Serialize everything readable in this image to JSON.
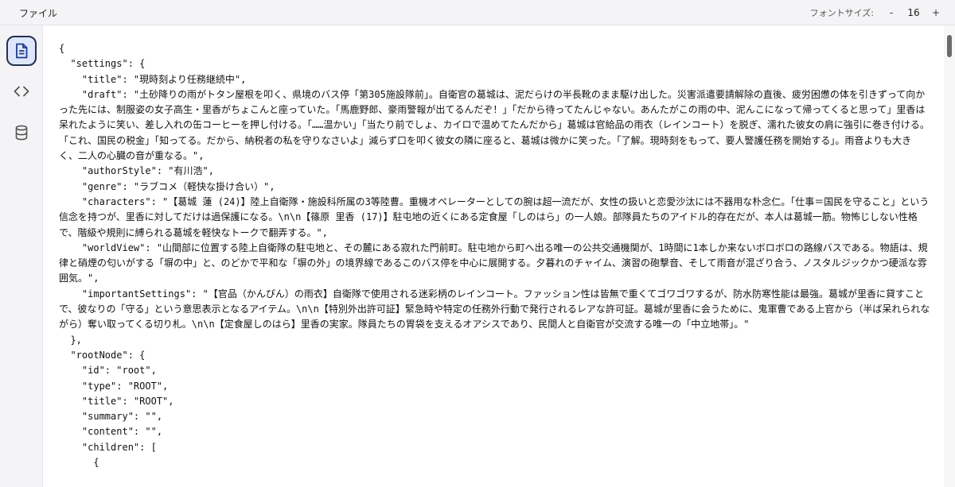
{
  "topbar": {
    "file_menu": "ファイル",
    "font_size_label": "フォントサイズ:",
    "decrease_label": "-",
    "font_size_value": "16",
    "increase_label": "+"
  },
  "sidebar": {
    "items": [
      {
        "icon": "document-icon",
        "active": true
      },
      {
        "icon": "code-icon",
        "active": false
      },
      {
        "icon": "database-icon",
        "active": false
      }
    ]
  },
  "editor": {
    "content": "{\n  \"settings\": {\n    \"title\": \"現時刻より任務継続中\",\n    \"draft\": \"土砂降りの雨がトタン屋根を叩く、県境のバス停「第305施設隊前」。自衛官の葛城は、泥だらけの半長靴のまま駆け出した。災害派遣要請解除の直後、疲労困憊の体を引きずって向かった先には、制服姿の女子高生・里香がちょこんと座っていた。「馬鹿野郎、豪雨警報が出てるんだぞ！」「だから待ってたんじゃない。あんたがこの雨の中、泥んこになって帰ってくると思って」里香は呆れたように笑い、差し入れの缶コーヒーを押し付ける。「……温かい」「当たり前でしょ、カイロで温めてたんだから」葛城は官給品の雨衣（レインコート）を脱ぎ、濡れた彼女の肩に強引に巻き付ける。「これ、国民の税金」「知ってる。だから、納税者の私を守りなさいよ」減らず口を叩く彼女の隣に座ると、葛城は微かに笑った。「了解。現時刻をもって、要人警護任務を開始する」。雨音よりも大きく、二人の心臓の音が重なる。\",\n    \"authorStyle\": \"有川浩\",\n    \"genre\": \"ラブコメ（軽快な掛け合い）\",\n    \"characters\": \"【葛城 蓮 (24)】陸上自衛隊・施設科所属の3等陸曹。重機オペレーターとしての腕は超一流だが、女性の扱いと恋愛沙汰には不器用な朴念仁。「仕事＝国民を守ること」という信念を持つが、里香に対してだけは過保護になる。\\n\\n【篠原 里香 (17)】駐屯地の近くにある定食屋「しのはら」の一人娘。部隊員たちのアイドル的存在だが、本人は葛城一筋。物怖じしない性格で、階級や規則に縛られる葛城を軽快なトークで翻弄する。\",\n    \"worldView\": \"山間部に位置する陸上自衛隊の駐屯地と、その麓にある寂れた門前町。駐屯地から町へ出る唯一の公共交通機関が、1時間に1本しか来ないボロボロの路線バスである。物語は、規律と硝煙の匂いがする「塀の中」と、のどかで平和な「塀の外」の境界線であるこのバス停を中心に展開する。夕暮れのチャイム、演習の砲撃音、そして雨音が混ざり合う、ノスタルジックかつ硬派な雰囲気。\",\n    \"importantSettings\": \"【官品（かんぴん）の雨衣】自衛隊で使用される迷彩柄のレインコート。ファッション性は皆無で重くてゴワゴワするが、防水防寒性能は最強。葛城が里香に貸すことで、彼なりの「守る」という意思表示となるアイテム。\\n\\n【特別外出許可証】緊急時や特定の任務外行動で発行されるレアな許可証。葛城が里香に会うために、鬼軍曹である上官から（半ば呆れられながら）奪い取ってくる切り札。\\n\\n【定食屋しのはら】里香の実家。隊員たちの胃袋を支えるオアシスであり、民間人と自衛官が交流する唯一の「中立地帯」。\"\n  },\n  \"rootNode\": {\n    \"id\": \"root\",\n    \"type\": \"ROOT\",\n    \"title\": \"ROOT\",\n    \"summary\": \"\",\n    \"content\": \"\",\n    \"children\": [\n      {"
  },
  "colors": {
    "chrome_bg": "#f4f4f6",
    "active_bg": "#dde6fb",
    "active_border": "#24324d",
    "scroll_thumb": "#6b6b6b"
  }
}
